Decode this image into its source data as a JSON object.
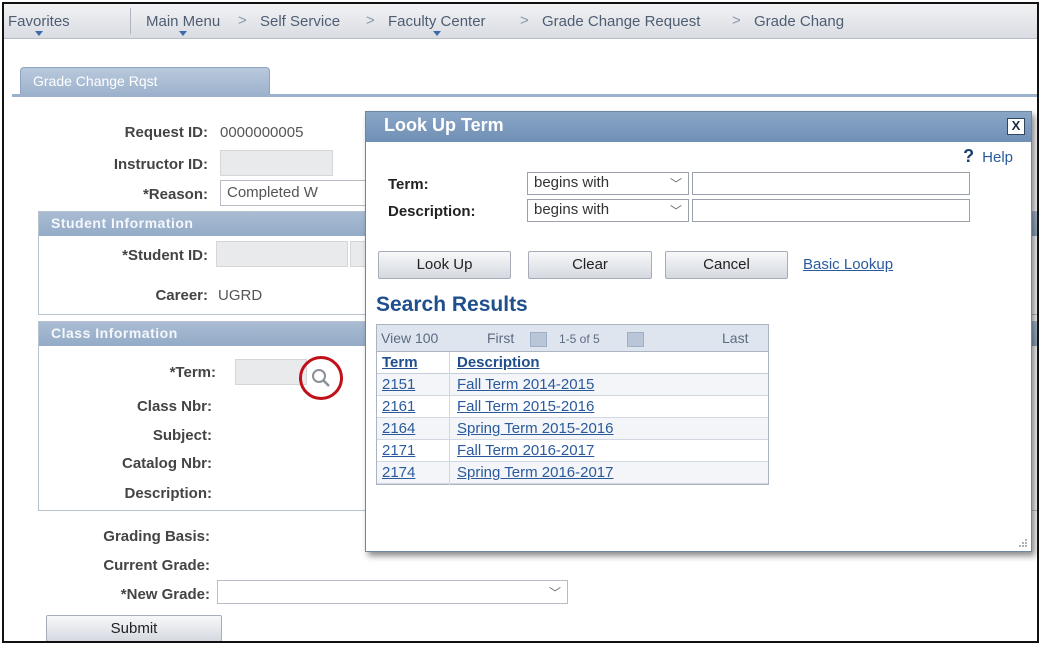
{
  "nav": {
    "favorites": "Favorites",
    "main_menu": "Main Menu",
    "sep": ">",
    "self_service": "Self Service",
    "faculty_center": "Faculty Center",
    "grade_change_request": "Grade Change Request",
    "grade_change_truncated": "Grade Chang"
  },
  "tab": {
    "label": "Grade Change Rqst"
  },
  "form": {
    "request_id_label": "Request ID:",
    "request_id_value": "0000000005",
    "instructor_id_label": "Instructor ID:",
    "reason_label": "*Reason:",
    "reason_value": "Completed W",
    "student_section": "Student Information",
    "student_id_label": "*Student ID:",
    "career_label": "Career:",
    "career_value": "UGRD",
    "class_section": "Class Information",
    "term_label": "*Term:",
    "class_nbr_label": "Class Nbr:",
    "subject_label": "Subject:",
    "catalog_nbr_label": "Catalog Nbr:",
    "description_label": "Description:",
    "grading_basis_label": "Grading Basis:",
    "current_grade_label": "Current Grade:",
    "new_grade_label": "*New Grade:",
    "new_grade_value": "",
    "submit_label": "Submit"
  },
  "modal": {
    "title": "Look Up Term",
    "close": "X",
    "help_icon": "?",
    "help": "Help",
    "term_label": "Term:",
    "term_operator": "begins with",
    "term_value": "",
    "desc_label": "Description:",
    "desc_operator": "begins with",
    "desc_value": "",
    "lookup_btn": "Look Up",
    "clear_btn": "Clear",
    "cancel_btn": "Cancel",
    "basic_lookup": "Basic Lookup",
    "results_title": "Search Results",
    "results_nav": {
      "view_all": "View 100",
      "first": "First",
      "range": "1-5 of 5",
      "last": "Last"
    },
    "columns": [
      "Term",
      "Description"
    ],
    "rows": [
      {
        "term": "2151",
        "description": "Fall Term 2014-2015"
      },
      {
        "term": "2161",
        "description": "Fall Term 2015-2016"
      },
      {
        "term": "2164",
        "description": "Spring Term 2015-2016"
      },
      {
        "term": "2171",
        "description": "Fall Term 2016-2017"
      },
      {
        "term": "2174",
        "description": "Spring Term 2016-2017"
      }
    ]
  },
  "icons": {
    "lookup": "magnifier-icon",
    "highlight_color": "#c0101a"
  }
}
